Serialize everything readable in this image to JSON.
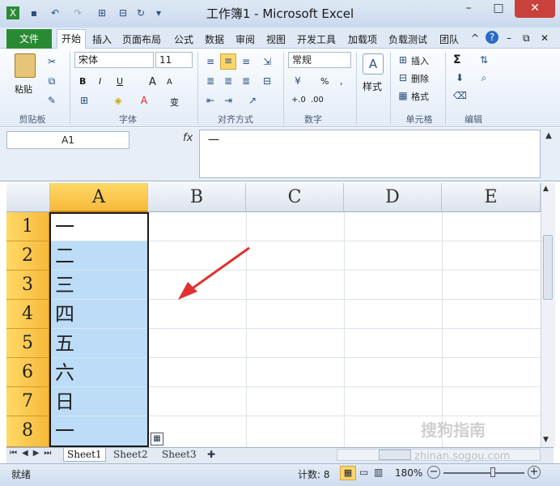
{
  "window": {
    "title": "工作簿1 - Microsoft Excel",
    "min": "–",
    "max": "□",
    "close": "✕"
  },
  "quick_access": [
    "excel-logo-icon",
    "save-icon",
    "undo-icon",
    "redo-icon",
    "customize-icon"
  ],
  "tabs": [
    "文件",
    "开始",
    "插入",
    "页面布局",
    "公式",
    "数据",
    "审阅",
    "视图",
    "开发工具",
    "加载项",
    "负载测试",
    "团队"
  ],
  "ribbon": {
    "clipboard": {
      "label": "剪贴板",
      "paste": "粘贴"
    },
    "font": {
      "label": "字体",
      "name": "宋体",
      "size": "11",
      "bold": "B",
      "italic": "I",
      "underline": "U",
      "grow": "A",
      "shrink": "A",
      "wen": "变"
    },
    "alignment": {
      "label": "对齐方式"
    },
    "number": {
      "label": "数字",
      "format": "常规",
      "percent": "%",
      "comma": ","
    },
    "styles": {
      "label": "样式"
    },
    "cells": {
      "label": "单元格",
      "insert": "插入",
      "delete": "删除",
      "format": "格式"
    },
    "editing": {
      "label": "编辑",
      "sum": "Σ"
    }
  },
  "formula_bar": {
    "name_box": "A1",
    "fx": "fx",
    "content": "一"
  },
  "columns": [
    "A",
    "B",
    "C",
    "D",
    "E"
  ],
  "rows": [
    "1",
    "2",
    "3",
    "4",
    "5",
    "6",
    "7",
    "8"
  ],
  "cells_a": [
    "一",
    "二",
    "三",
    "四",
    "五",
    "六",
    "日",
    "一"
  ],
  "sheets": [
    "Sheet1",
    "Sheet2",
    "Sheet3"
  ],
  "status": {
    "ready": "就绪",
    "count": "计数: 8",
    "zoom": "180%"
  },
  "watermark": {
    "brand": "搜狗指南",
    "url": "zhinan.sogou.com"
  }
}
